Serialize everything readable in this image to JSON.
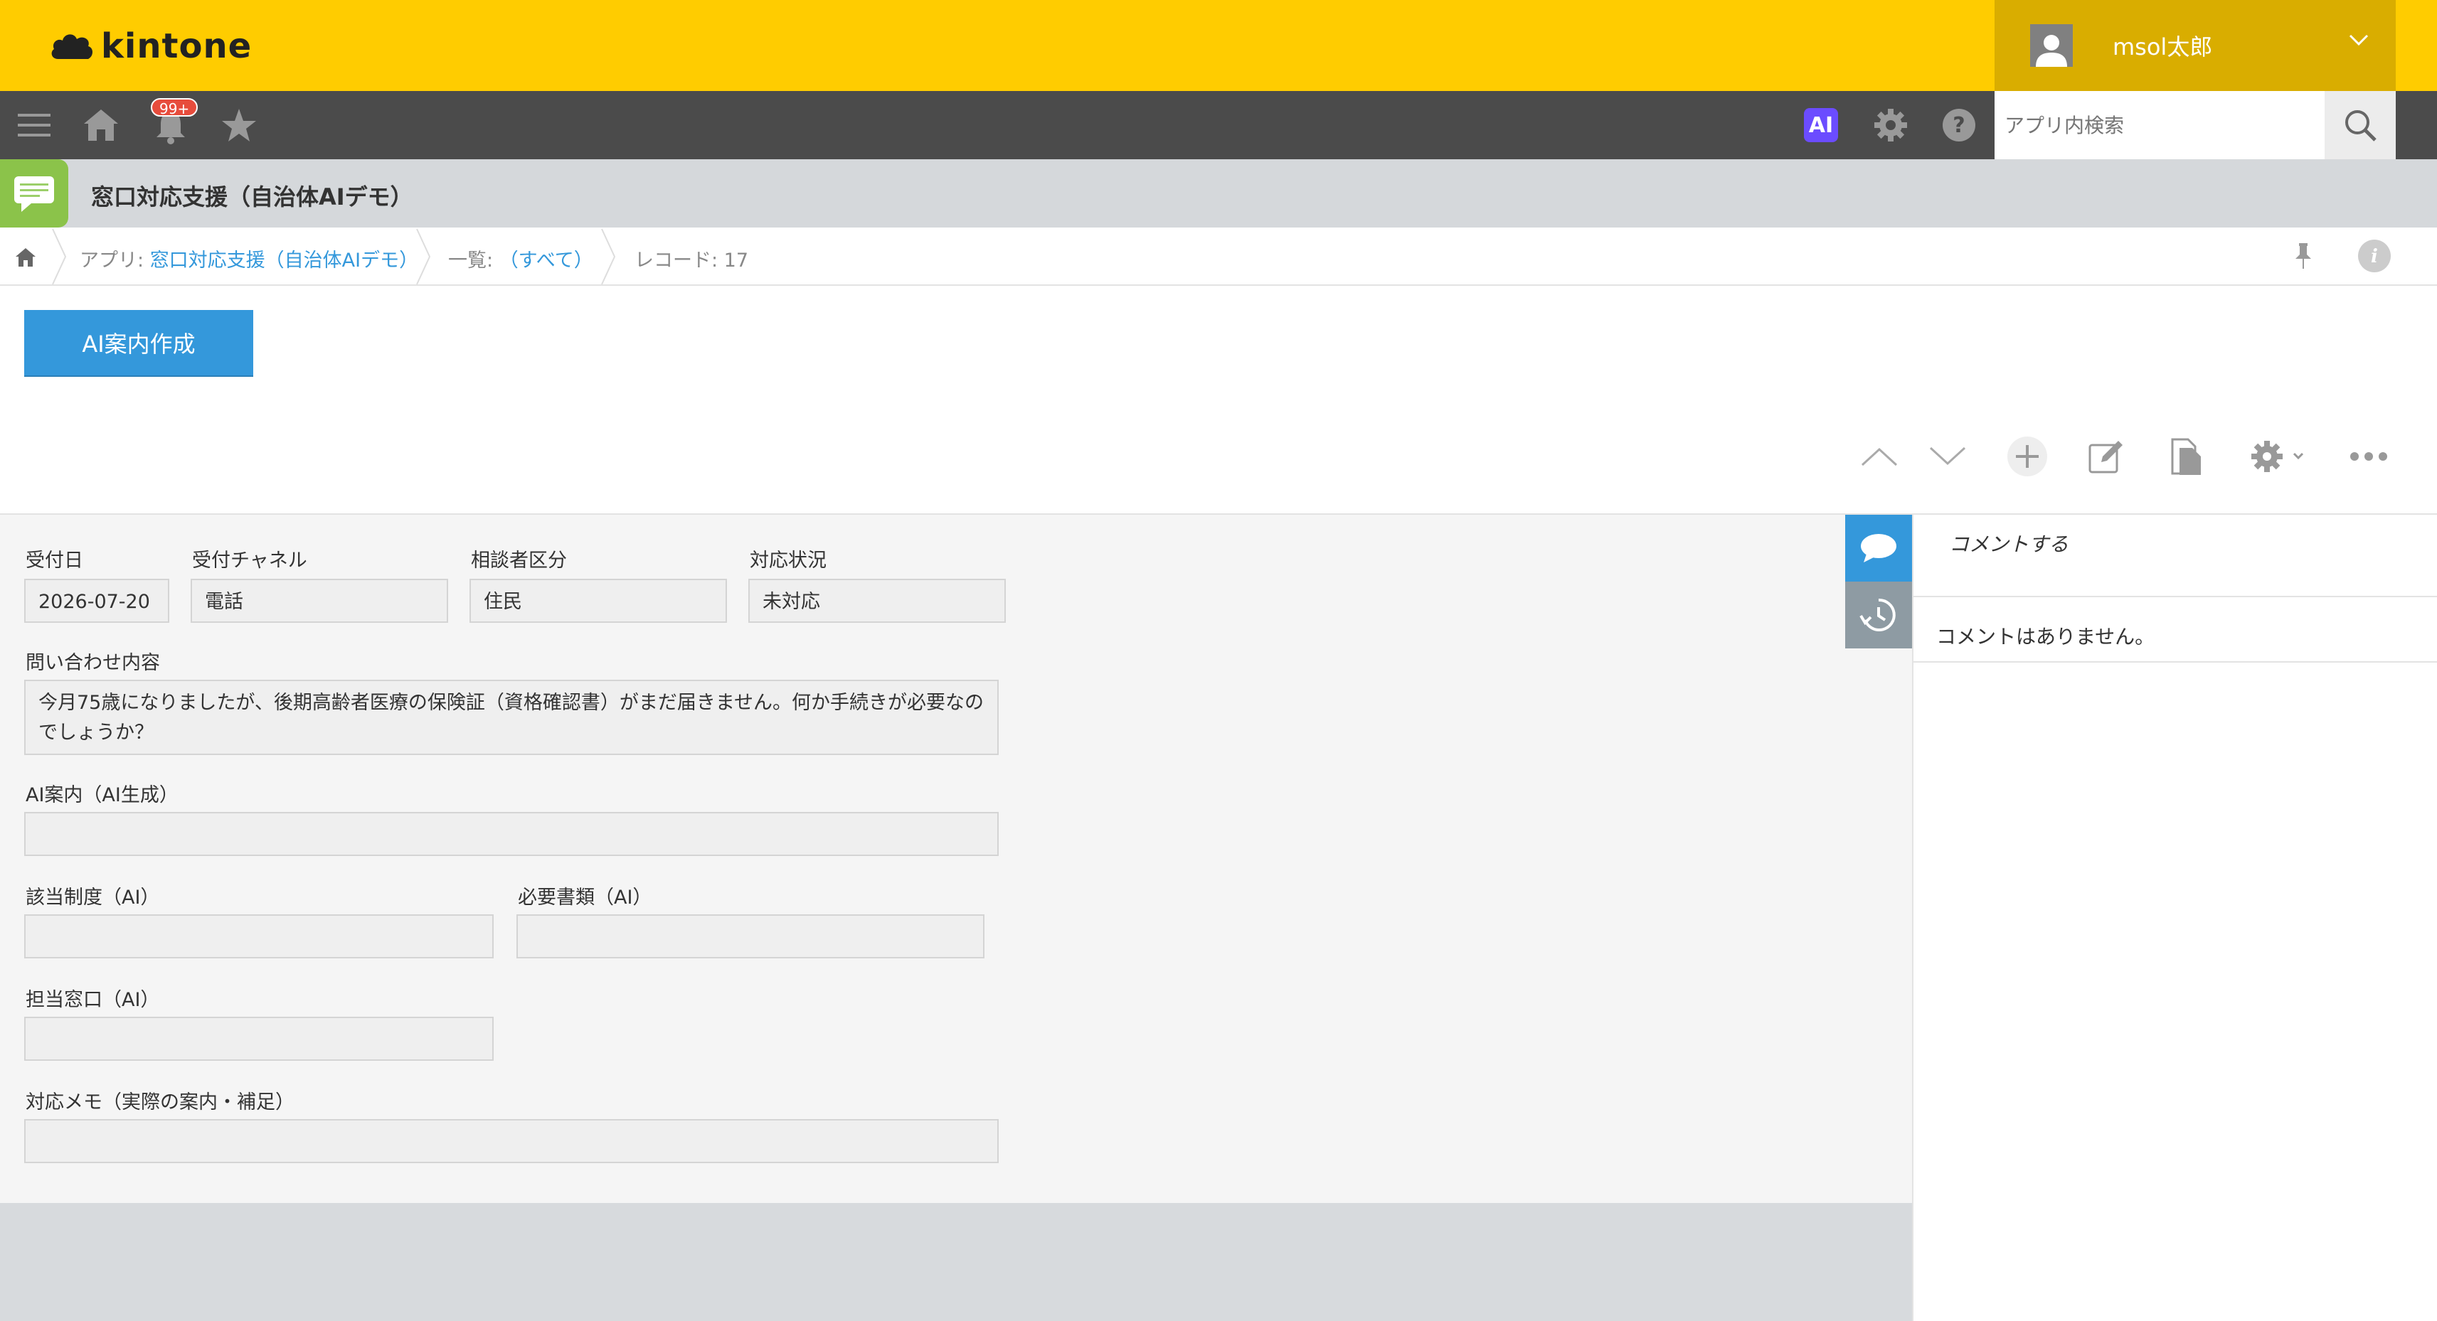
{
  "header": {
    "logo_text": "kintone",
    "user_name": "msol太郎",
    "notification_badge": "99+",
    "ai_label": "AI",
    "search_placeholder": "アプリ内検索",
    "brand_color": "#ffcc00"
  },
  "app": {
    "title": "窓口対応支援（自治体AIデモ）"
  },
  "breadcrumb": {
    "app_prefix": "アプリ: ",
    "app_name": "窓口対応支援（自治体AIデモ）",
    "list_prefix": "一覧: ",
    "list_name": "（すべて）",
    "record_label": "レコード: 17"
  },
  "toolbar": {
    "ai_create_label": "AI案内作成",
    "button_color": "#3498db"
  },
  "form": {
    "received_date": {
      "label": "受付日",
      "value": "2026-07-20"
    },
    "channel": {
      "label": "受付チャネル",
      "value": "電話"
    },
    "consultant_type": {
      "label": "相談者区分",
      "value": "住民"
    },
    "status": {
      "label": "対応状況",
      "value": "未対応"
    },
    "inquiry": {
      "label": "問い合わせ内容",
      "value": "今月75歳になりましたが、後期高齢者医療の保険証（資格確認書）がまだ届きません。何か手続きが必要なのでしょうか？"
    },
    "ai_guidance": {
      "label": "AI案内（AI生成）",
      "value": ""
    },
    "system": {
      "label": "該当制度（AI）",
      "value": ""
    },
    "documents": {
      "label": "必要書類（AI）",
      "value": ""
    },
    "desk": {
      "label": "担当窓口（AI）",
      "value": ""
    },
    "memo": {
      "label": "対応メモ（実際の案内・補足）",
      "value": ""
    }
  },
  "sidepanel": {
    "comment_placeholder": "コメントする",
    "no_comments": "コメントはありません。"
  }
}
